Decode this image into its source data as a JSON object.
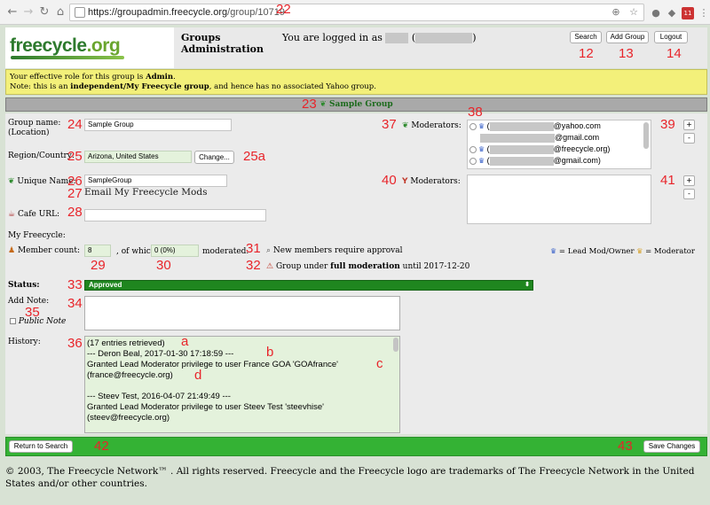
{
  "browser": {
    "url_host": "https://groupadmin.freecycle.org",
    "url_path": "/group/10719"
  },
  "header": {
    "logo_text_main": "freecycle",
    "logo_text_tld": ".org",
    "title": "Groups Administration",
    "logged_in_prefix": "You are logged in as",
    "buttons": {
      "search": "Search",
      "add_group": "Add Group",
      "logout": "Logout"
    }
  },
  "notice": {
    "role_prefix": "Your effective role for this group is",
    "role": "Admin",
    "note_prefix": "Note: this is an",
    "note_bold": "independent/My Freecycle group",
    "note_suffix": ", and hence has no associated Yahoo group."
  },
  "group_title": "Sample Group",
  "form": {
    "group_name_label": "Group name:",
    "group_name_sub": "(Location)",
    "group_name_value": "Sample Group",
    "region_label": "Region/Country:",
    "region_value": "Arizona, United States",
    "change_button": "Change...",
    "unique_name_label": "Unique Name:",
    "unique_name_value": "SampleGroup",
    "email_mods_link": "Email My Freecycle Mods",
    "cafe_url_label": "Cafe URL:",
    "cafe_url_value": "",
    "my_freecycle_label": "My Freecycle:",
    "member_count_label": "Member count:",
    "member_count_value": "8",
    "of_which": ", of which",
    "moderated_value": "0 (0%)",
    "moderated_label": "moderated.",
    "approval_text": "New members require approval",
    "full_mod_prefix": "Group under",
    "full_mod_bold": "full moderation",
    "full_mod_suffix": "until 2017-12-20",
    "moderators_label": "Moderators:",
    "yahoo_moderators_label": "Moderators:",
    "moderators": [
      {
        "email": "@yahoo.com"
      },
      {
        "email": "@gmail.com"
      },
      {
        "email": "@freecycle.org)"
      },
      {
        "email": "@gmail.com)"
      }
    ],
    "legend_lead": "= Lead Mod/Owner",
    "legend_mod": "= Moderator",
    "status_label": "Status:",
    "status_value": "Approved",
    "add_note_label": "Add Note:",
    "public_note_label": "Public Note",
    "history_label": "History:",
    "history_text": "(17 entries retrieved)\n--- Deron Beal, 2017-01-30 17:18:59 ---\nGranted Lead Moderator privilege to user France GOA 'GOAfrance'\n(france@freecycle.org)\n\n--- Steev Test, 2016-04-07 21:49:49 ---\nGranted Lead Moderator privilege to user Steev Test 'steevhise'\n(steev@freecycle.org)"
  },
  "footer": {
    "return_button": "Return to Search",
    "save_button": "Save Changes",
    "copyright": "© 2003, The Freecycle Network™ . All rights reserved. Freecycle and the Freecycle logo are trademarks of The Freecycle Network in the United States and/or other countries."
  },
  "markers": {
    "m12": "12",
    "m13": "13",
    "m14": "14",
    "m22": "22",
    "m23": "23",
    "m24": "24",
    "m25": "25",
    "m25a": "25a",
    "m26": "26",
    "m27": "27",
    "m28": "28",
    "m29": "29",
    "m30": "30",
    "m31": "31",
    "m32": "32",
    "m33": "33",
    "m34": "34",
    "m35": "35",
    "m36": "36",
    "m37": "37",
    "m38": "38",
    "m39": "39",
    "m40": "40",
    "m41": "41",
    "m42": "42",
    "m43": "43",
    "ma": "a",
    "mb": "b",
    "mc": "c",
    "md": "d"
  },
  "colors": {
    "notice_bg": "#f3f07a",
    "status_green": "#1f861f",
    "footer_green": "#34b234",
    "marker_red": "#e8242a"
  }
}
